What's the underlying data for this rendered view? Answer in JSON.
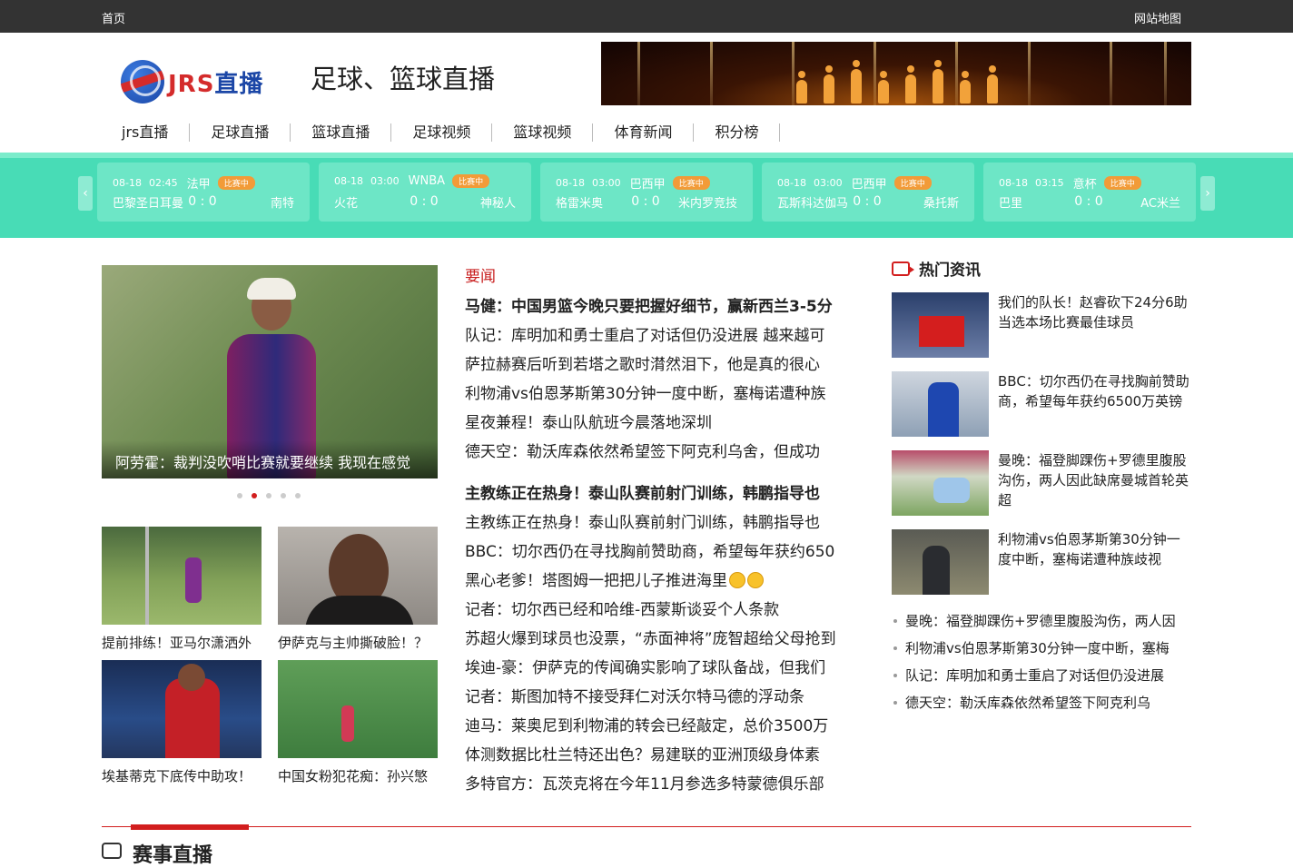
{
  "topbar": {
    "home": "首页",
    "sitemap": "网站地图"
  },
  "header": {
    "logo_latin": "JRS",
    "logo_cn": "直播",
    "title": "足球、篮球直播"
  },
  "nav": [
    "jrs直播",
    "足球直播",
    "篮球直播",
    "足球视频",
    "篮球视频",
    "体育新闻",
    "积分榜"
  ],
  "scores": {
    "prev": "‹",
    "next": "›",
    "matches": [
      {
        "date": "08-18",
        "time": "02:45",
        "league": "法甲",
        "status": "比赛中",
        "home": "巴黎圣日耳曼",
        "score": "0 : 0",
        "away": "南特"
      },
      {
        "date": "08-18",
        "time": "03:00",
        "league": "WNBA",
        "status": "比赛中",
        "home": "火花",
        "score": "0 : 0",
        "away": "神秘人"
      },
      {
        "date": "08-18",
        "time": "03:00",
        "league": "巴西甲",
        "status": "比赛中",
        "home": "格雷米奥",
        "score": "0 : 0",
        "away": "米内罗竞技"
      },
      {
        "date": "08-18",
        "time": "03:00",
        "league": "巴西甲",
        "status": "比赛中",
        "home": "瓦斯科达伽马",
        "score": "0 : 0",
        "away": "桑托斯"
      },
      {
        "date": "08-18",
        "time": "03:15",
        "league": "意杯",
        "status": "比赛中",
        "home": "巴里",
        "score": "0 : 0",
        "away": "AC米兰"
      }
    ]
  },
  "slider": {
    "caption": "阿劳霍：裁判没吹哨比赛就要继续 我现在感觉身",
    "dots": 5,
    "active_dot": 2
  },
  "thumbs": [
    {
      "caption": "提前排练！亚马尔潇洒外"
    },
    {
      "caption": "伊萨克与主帅撕破脸！？"
    },
    {
      "caption": "埃基蒂克下底传中助攻！"
    },
    {
      "caption": "中国女粉犯花痴：孙兴慜"
    }
  ],
  "news": {
    "heading": "要闻",
    "group1": [
      {
        "text": "马健：中国男篮今晚只要把握好细节，赢新西兰3-5分",
        "bold": true
      },
      {
        "text": "队记：库明加和勇士重启了对话但仍没进展 越来越可"
      },
      {
        "text": "萨拉赫赛后听到若塔之歌时潸然泪下，他是真的很心"
      },
      {
        "text": "利物浦vs伯恩茅斯第30分钟一度中断，塞梅诺遭种族"
      },
      {
        "text": "星夜兼程！泰山队航班今晨落地深圳"
      },
      {
        "text": "德天空：勒沃库森依然希望签下阿克利乌舍，但成功"
      }
    ],
    "group2": [
      {
        "text": "主教练正在热身！泰山队赛前射门训练，韩鹏指导也",
        "bold": true
      },
      {
        "text": "主教练正在热身！泰山队赛前射门训练，韩鹏指导也"
      },
      {
        "text": "BBC：切尔西仍在寻找胸前赞助商，希望每年获约650"
      },
      {
        "text": "黑心老爹！塔图姆一把把儿子推进海里",
        "emoji": 2
      },
      {
        "text": "记者：切尔西已经和哈维-西蒙斯谈妥个人条款"
      },
      {
        "text": "苏超火爆到球员也没票，“赤面神将”庞智超给父母抢到"
      },
      {
        "text": "埃迪-豪：伊萨克的传闻确实影响了球队备战，但我们"
      },
      {
        "text": "记者：斯图加特不接受拜仁对沃尔特马德的浮动条"
      },
      {
        "text": "迪马：莱奥尼到利物浦的转会已经敲定，总价3500万"
      },
      {
        "text": "体测数据比杜兰特还出色？易建联的亚洲顶级身体素"
      },
      {
        "text": "多特官方：瓦茨克将在今年11月参选多特蒙德俱乐部"
      }
    ]
  },
  "hot": {
    "heading": "热门资讯",
    "items": [
      {
        "text": "我们的队长！赵睿砍下24分6助 当选本场比赛最佳球员"
      },
      {
        "text": "BBC：切尔西仍在寻找胸前赞助商，希望每年获约6500万英镑"
      },
      {
        "text": "曼晚：福登脚踝伤+罗德里腹股沟伤，两人因此缺席曼城首轮英超"
      },
      {
        "text": "利物浦vs伯恩茅斯第30分钟一度中断，塞梅诺遭种族歧视"
      }
    ],
    "list": [
      "曼晚：福登脚踝伤+罗德里腹股沟伤，两人因",
      "利物浦vs伯恩茅斯第30分钟一度中断，塞梅",
      "队记：库明加和勇士重启了对话但仍没进展",
      "德天空：勒沃库森依然希望签下阿克利乌"
    ]
  },
  "bottom": {
    "title": "赛事直播"
  }
}
